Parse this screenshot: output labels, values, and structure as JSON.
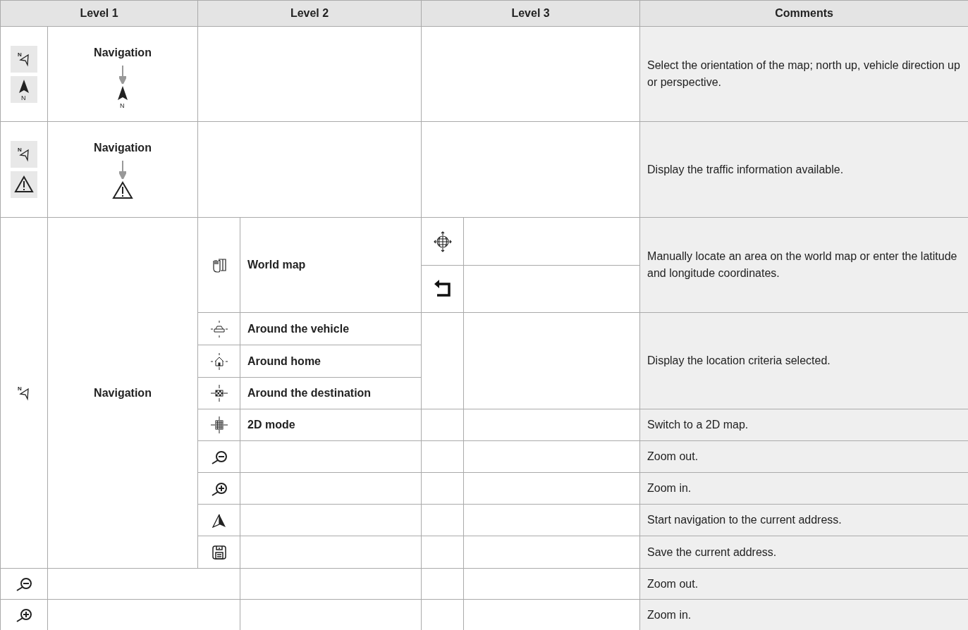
{
  "columns": [
    "Level 1",
    "Level 2",
    "Level 3",
    "Comments"
  ],
  "sections": [
    {
      "nav_icon_letter": "N",
      "north_icon_letter": "N",
      "level1": "Navigation",
      "result_letter": "N",
      "comment": "Select the orientation of the map; north up, vehicle direction up or perspective."
    },
    {
      "nav_icon_letter": "N",
      "level1": "Navigation",
      "comment": "Display the traffic information available."
    },
    {
      "nav_icon_letter": "N",
      "level1": "Navigation",
      "level2": [
        "World map",
        "Around the vehicle",
        "Around home",
        "Around the destination",
        "2D mode"
      ],
      "comments": [
        "Manually locate an area on the world map or enter the latitude and longitude coordinates.",
        "Display the location criteria selected.",
        "Switch to a 2D map.",
        "Zoom out.",
        "Zoom in.",
        "Start navigation to the current address.",
        "Save the current address."
      ]
    },
    {
      "comment": "Zoom out."
    },
    {
      "comment": "Zoom in."
    }
  ]
}
